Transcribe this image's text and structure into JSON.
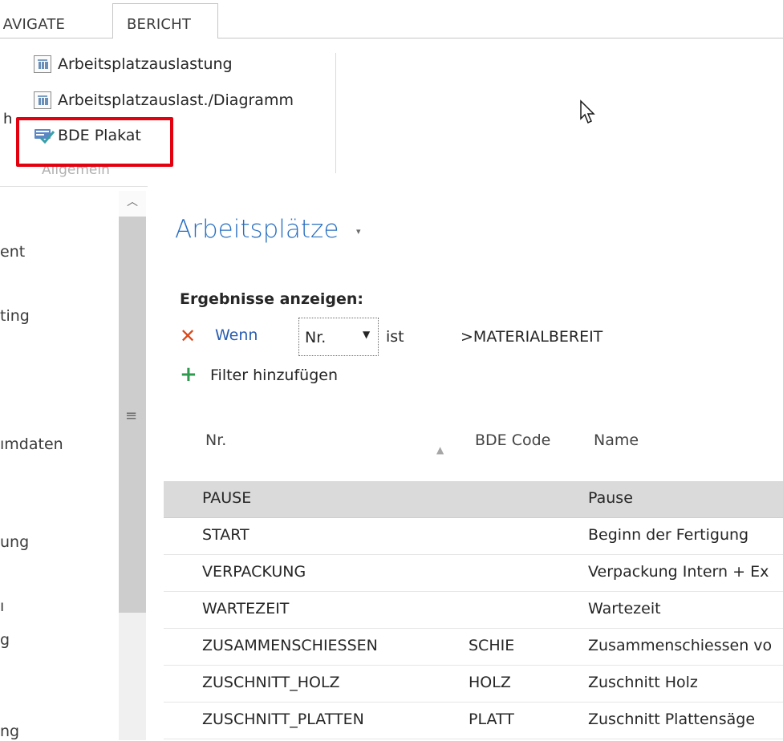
{
  "ribbon": {
    "tabs": [
      {
        "label": "NAVIGATE"
      },
      {
        "label": "BERICHT"
      }
    ],
    "visible_tab_fragment": "AVIGATE",
    "items": [
      {
        "label": "Arbeitsplatzauslastung",
        "icon": "report-icon"
      },
      {
        "label": "Arbeitsplatzauslast./Diagramm",
        "icon": "report-chart-icon"
      },
      {
        "label": "BDE Plakat",
        "icon": "bde-poster-icon"
      }
    ],
    "partial_left_letter": "h",
    "group_label": "Allgemein"
  },
  "nav": {
    "items": [
      "ent",
      "ting",
      "ımdaten",
      "ung",
      "ı",
      "g",
      "ng"
    ]
  },
  "content": {
    "title": "Arbeitsplätze",
    "filter": {
      "heading": "Ergebnisse anzeigen:",
      "when_label": "Wenn",
      "field": "Nr.",
      "operator": "ist",
      "value": ">MATERIALBEREIT",
      "add_label": "Filter hinzufügen"
    },
    "columns": [
      "Nr.",
      "BDE Code",
      "Name"
    ],
    "rows": [
      {
        "nr": "PAUSE",
        "bde": "",
        "name": "Pause"
      },
      {
        "nr": "START",
        "bde": "",
        "name": "Beginn der Fertigung"
      },
      {
        "nr": "VERPACKUNG",
        "bde": "",
        "name": "Verpackung Intern + Ex"
      },
      {
        "nr": "WARTEZEIT",
        "bde": "",
        "name": "Wartezeit"
      },
      {
        "nr": "ZUSAMMENSCHIESSEN",
        "bde": "SCHIE",
        "name": "Zusammenschiessen vo"
      },
      {
        "nr": "ZUSCHNITT_HOLZ",
        "bde": "HOLZ",
        "name": "Zuschnitt Holz"
      },
      {
        "nr": "ZUSCHNITT_PLATTEN",
        "bde": "PLATT",
        "name": "Zuschnitt Plattensäge"
      }
    ]
  },
  "colors": {
    "title_blue": "#2a70c1",
    "highlight_red": "#e3000f",
    "selected_row": "#dadada",
    "remove_red": "#d9491c",
    "add_green": "#2e9b4f"
  }
}
